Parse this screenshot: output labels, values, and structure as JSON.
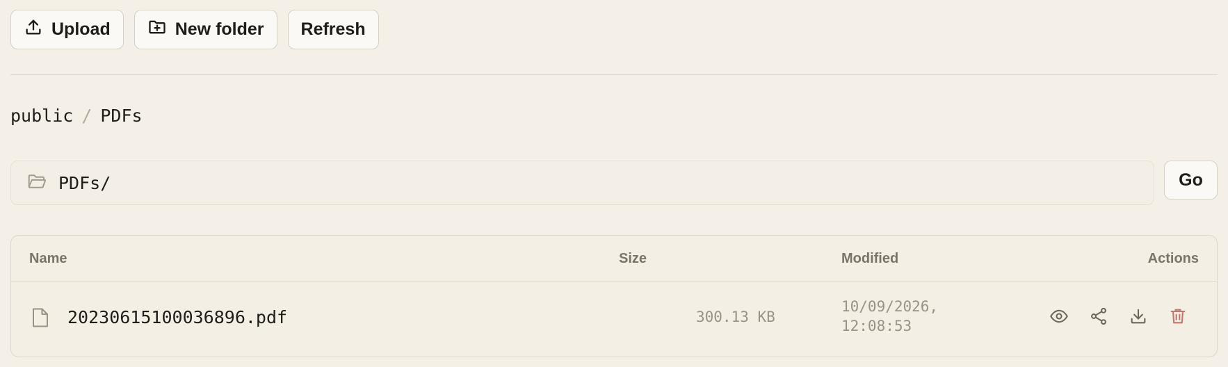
{
  "toolbar": {
    "upload_label": "Upload",
    "new_folder_label": "New folder",
    "refresh_label": "Refresh"
  },
  "breadcrumb": {
    "items": [
      "public",
      "PDFs"
    ],
    "separator": "/"
  },
  "path_bar": {
    "value": "PDFs/",
    "go_label": "Go"
  },
  "table": {
    "columns": [
      "Name",
      "Size",
      "Modified",
      "Actions"
    ],
    "rows": [
      {
        "name": "20230615100036896.pdf",
        "size": "300.13 KB",
        "modified_date": "10/09/2026,",
        "modified_time": "12:08:53",
        "actions": [
          "eye-icon",
          "share-icon",
          "download-icon",
          "trash-icon"
        ]
      }
    ]
  },
  "colors": {
    "background": "#f4f0e8",
    "delete": "#c0786e"
  }
}
